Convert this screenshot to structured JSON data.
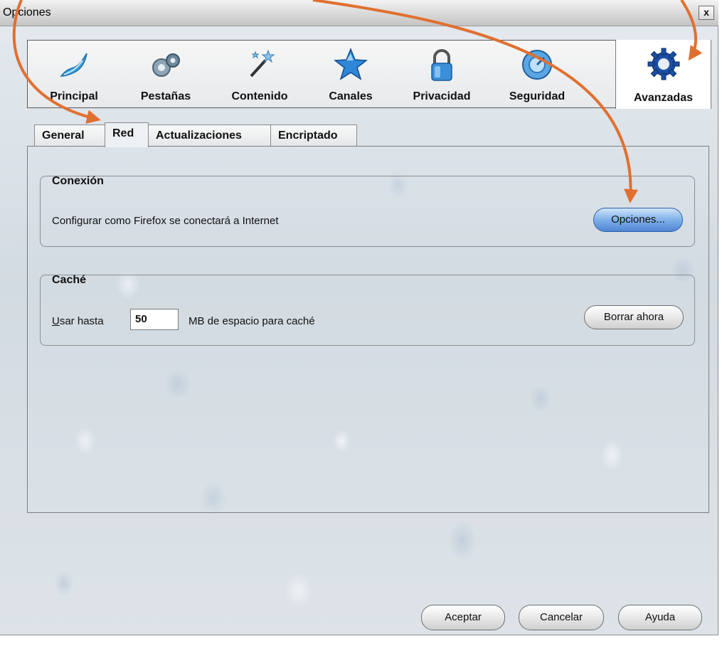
{
  "window": {
    "title": "Opciones",
    "close_label": "x"
  },
  "toolbar": {
    "panes": [
      {
        "label": "Principal",
        "icon": "principal-icon"
      },
      {
        "label": "Pestañas",
        "icon": "tabs-gear-icon"
      },
      {
        "label": "Contenido",
        "icon": "content-wand-icon"
      },
      {
        "label": "Canales",
        "icon": "feeds-star-icon"
      },
      {
        "label": "Privacidad",
        "icon": "lock-icon"
      },
      {
        "label": "Seguridad",
        "icon": "security-icon"
      },
      {
        "label": "Avanzadas",
        "icon": "advanced-gear-icon",
        "selected": true
      }
    ]
  },
  "tabs": [
    {
      "label": "General"
    },
    {
      "label": "Red",
      "active": true
    },
    {
      "label": "Actualizaciones"
    },
    {
      "label": "Encriptado"
    }
  ],
  "connection": {
    "title": "Conexión",
    "description": "Configurar como Firefox se conectará a Internet",
    "button": "Opciones..."
  },
  "cache": {
    "title": "Caché",
    "use_prefix": "U",
    "use_rest": "sar hasta",
    "value": "50",
    "suffix": "MB de espacio para caché",
    "button": "Borrar ahora"
  },
  "footer": {
    "ok": "Aceptar",
    "cancel": "Cancelar",
    "help": "Ayuda"
  },
  "colors": {
    "arrow": "#e07030",
    "selected_button": "#6fa3e4"
  }
}
